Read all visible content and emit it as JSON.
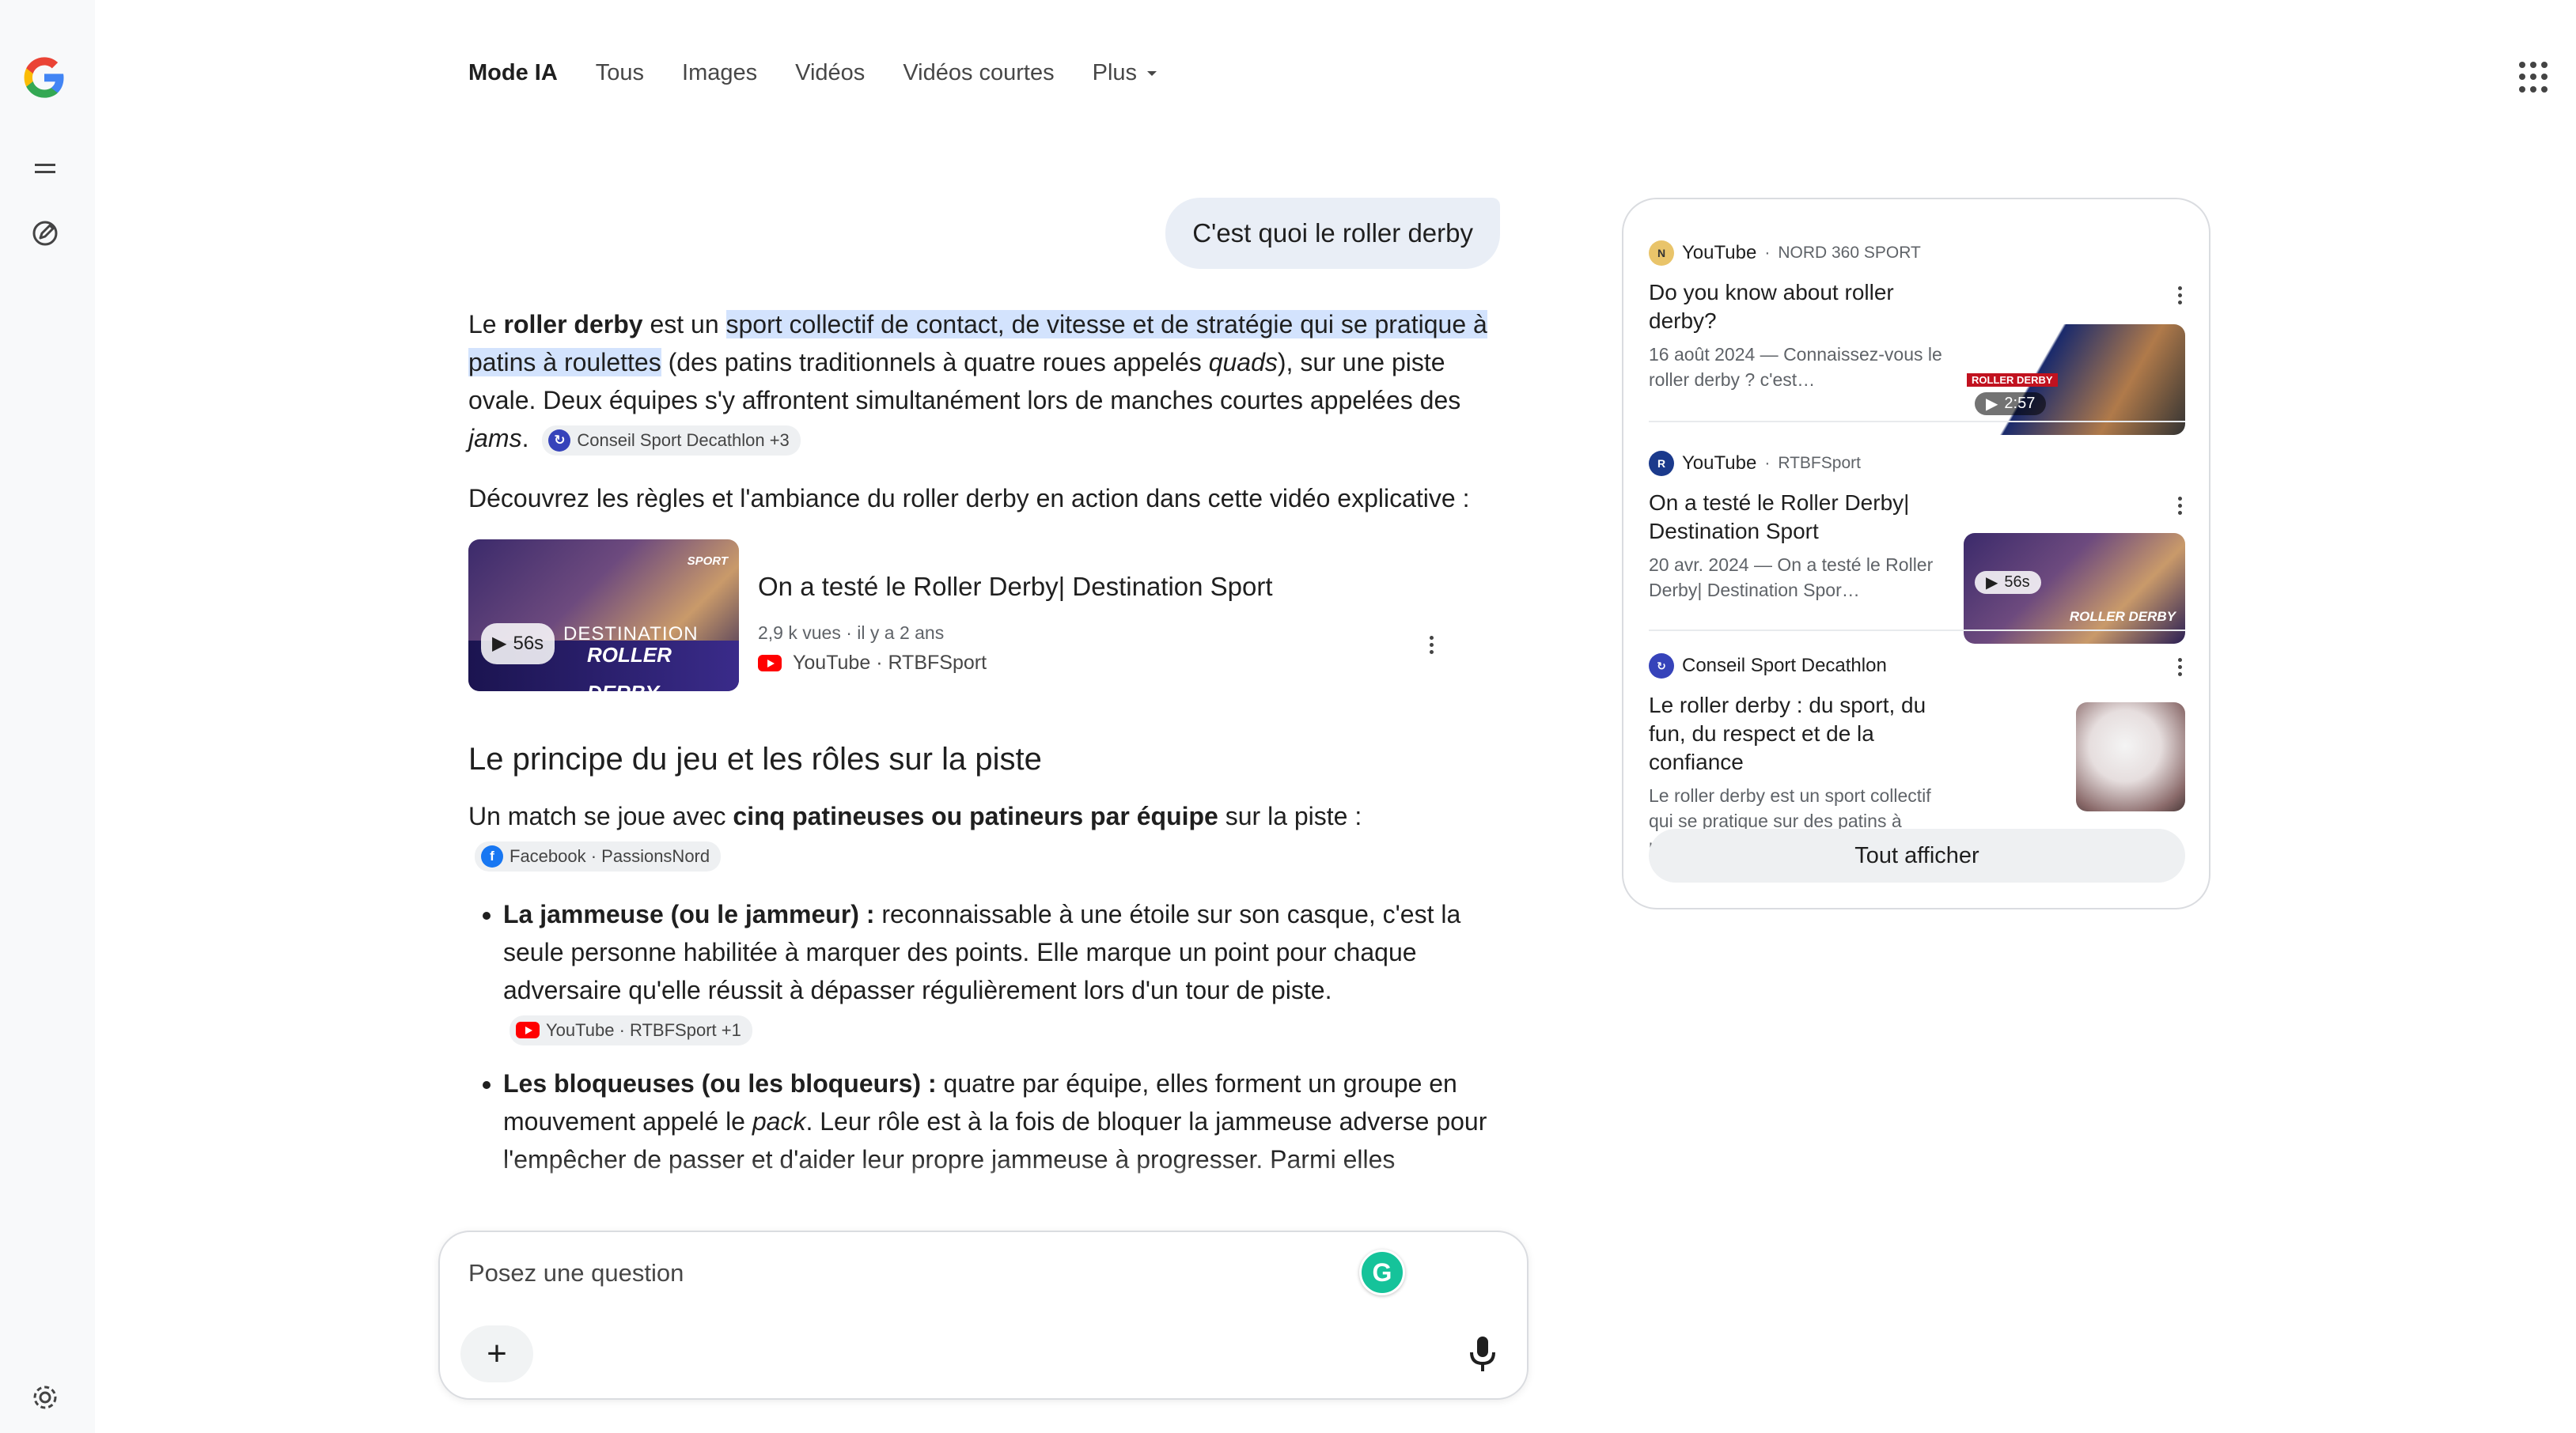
{
  "nav": {
    "tabs": [
      {
        "label": "Mode IA",
        "active": true
      },
      {
        "label": "Tous"
      },
      {
        "label": "Images"
      },
      {
        "label": "Vidéos"
      },
      {
        "label": "Vidéos courtes"
      },
      {
        "label": "Plus"
      }
    ],
    "icons": [
      "google-g-icon",
      "menu-icon",
      "new-chat-icon",
      "settings-icon",
      "apps-grid-icon",
      "chevron-down-icon"
    ]
  },
  "conversation": {
    "user_query": "C'est quoi le roller derby"
  },
  "answer": {
    "p1": {
      "t1": "Le ",
      "b1": "roller derby",
      "t2": " est un ",
      "hl": "sport collectif de contact, de vitesse et de stratégie qui se pratique à patins à roulettes",
      "t3": " (des patins traditionnels à quatre roues appelés ",
      "i1": "quads",
      "t4": "), sur une piste ovale. Deux équipes s'y affrontent simultanément lors de manches courtes appelées des ",
      "i2": "jams",
      "t5": ".",
      "chip": "Conseil Sport Decathlon +3"
    },
    "p2": "Découvrez les règles et l'ambiance du roller derby en action dans cette vidéo explicative :",
    "video": {
      "title": "On a testé le Roller Derby| Destination Sport",
      "meta": "2,9 k vues · il y a 2 ans",
      "source": "YouTube · RTBFSport",
      "duration": "56s",
      "thumb_line1": "DESTINATION",
      "thumb_line2": "ROLLER DERBY",
      "thumb_badge": "SPORT"
    },
    "h2": "Le principe du jeu et les rôles sur la piste",
    "p3": {
      "t1": "Un match se joue avec ",
      "b1": "cinq patineuses ou patineurs par équipe",
      "t2": " sur la piste :",
      "chip": "Facebook · PassionsNord"
    },
    "bullets": [
      {
        "bold": "La jammeuse (ou le jammeur) :",
        "text": " reconnaissable à une étoile sur son casque, c'est la seule personne habilitée à marquer des points. Elle marque un point pour chaque adversaire qu'elle réussit à dépasser régulièrement lors d'un tour de piste.",
        "chip": "YouTube · RTBFSport +1"
      },
      {
        "bold": "Les bloqueuses (ou les bloqueurs) :",
        "text1": " quatre par équipe, elles forment un groupe en mouvement appelé le ",
        "italic": "pack",
        "text2": ". Leur rôle est à la fois de bloquer la jammeuse adverse pour l'empêcher de passer et d'aider leur propre jammeuse à progresser. Parmi elles"
      }
    ]
  },
  "input": {
    "placeholder": "Posez une question",
    "plus_label": "+"
  },
  "sources": {
    "items": [
      {
        "site": "YouTube",
        "channel": "NORD 360 SPORT",
        "title": "Do you know about roller derby?",
        "desc": "16 août 2024 — Connaissez-vous le roller derby ? c'est…",
        "duration": "2:57",
        "thumb_text": "ROLLER DERBY"
      },
      {
        "site": "YouTube",
        "channel": "RTBFSport",
        "title": "On a testé le Roller Derby| Destination Sport",
        "desc": "20 avr. 2024 — On a testé le Roller Derby| Destination Spor…",
        "duration": "56s",
        "thumb_text": "ROLLER DERBY"
      },
      {
        "site": "Conseil Sport Decathlon",
        "channel": "",
        "title": "Le roller derby : du sport, du fun, du respect et de la confiance",
        "desc": "Le roller derby est un sport collectif qui se pratique sur des patins à roulettes sur une…"
      }
    ],
    "show_all": "Tout afficher"
  },
  "colors": {
    "highlight": "#d3e3fd",
    "user_bubble": "#e9eef6",
    "youtube_red": "#ff0000",
    "decathlon_blue": "#3643ba",
    "facebook_blue": "#1877f2",
    "grammarly_green": "#15c39a"
  }
}
